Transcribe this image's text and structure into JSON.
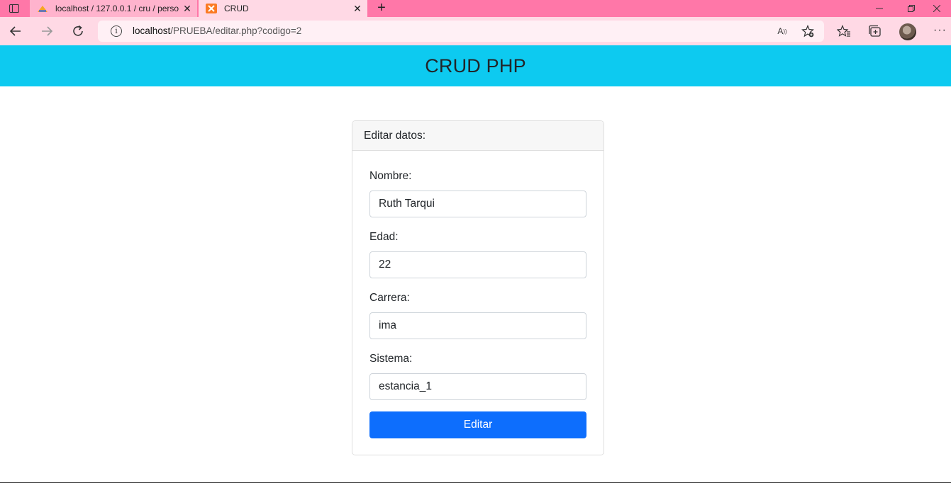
{
  "browser": {
    "tabs": [
      {
        "title": "localhost / 127.0.0.1 / cru / perso",
        "icon": "phpmyadmin-icon",
        "active": false
      },
      {
        "title": "CRUD",
        "icon": "xampp-icon",
        "active": true
      }
    ],
    "close_glyph": "✕",
    "new_tab_glyph": "+",
    "url_host": "localhost",
    "url_path": "/PRUEBA/editar.php?codigo=2",
    "colors": {
      "tabbar": "#ff77a8",
      "toolbar": "#ffd9e5"
    }
  },
  "page": {
    "header_title": "CRUD PHP",
    "header_color": "#0dcaf0"
  },
  "form": {
    "card_title": "Editar datos:",
    "fields": [
      {
        "label": "Nombre:",
        "value": "Ruth Tarqui"
      },
      {
        "label": "Edad:",
        "value": "22"
      },
      {
        "label": "Carrera:",
        "value": "ima"
      },
      {
        "label": "Sistema:",
        "value": "estancia_1"
      }
    ],
    "submit_label": "Editar",
    "submit_color": "#0d6efd"
  }
}
